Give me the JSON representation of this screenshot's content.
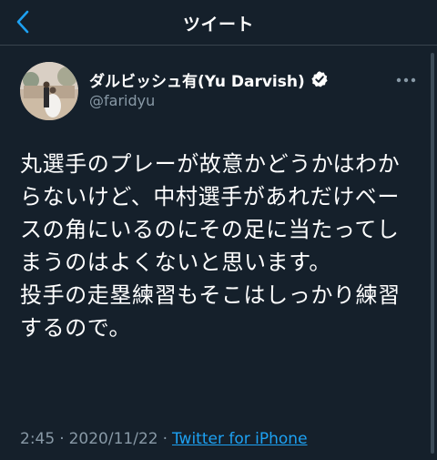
{
  "header": {
    "title": "ツイート",
    "back_icon": "chevron-left-icon"
  },
  "author": {
    "display_name": "ダルビッシュ有(Yu Darvish)",
    "handle": "@faridyu",
    "verified": true,
    "avatar_icon": "profile-photo"
  },
  "tweet": {
    "text": "丸選手のプレーが故意かどうかはわからないけど、中村選手があれだけベースの角にいるのにその足に当たってしまうのはよくないと思います。\n投手の走塁練習もそこはしっかり練習するので。",
    "time": "2:45",
    "separator": "·",
    "date": "2020/11/22",
    "source": "Twitter for iPhone"
  },
  "colors": {
    "background": "#15202b",
    "secondary_text": "#8899a6",
    "accent": "#1da1f2",
    "divider": "#38444d"
  }
}
